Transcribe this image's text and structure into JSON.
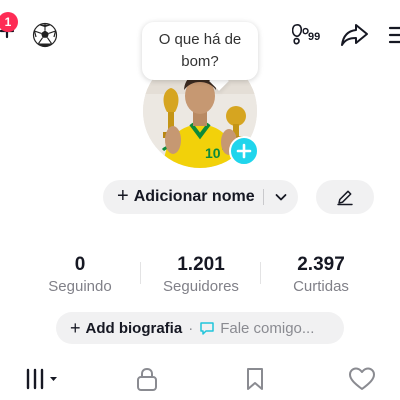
{
  "top_bar": {
    "notification_count": "1",
    "icons": [
      "plus-icon",
      "soccer-ball-icon",
      "footprints-icon",
      "share-icon",
      "menu-icon"
    ],
    "visitors_count": "99"
  },
  "bubble": {
    "text_line1": "O que há de",
    "text_line2": "bom?"
  },
  "profile": {
    "add_name_label": "Adicionar nome",
    "add_symbol": "+"
  },
  "stats": [
    {
      "value": "0",
      "label": "Seguindo"
    },
    {
      "value": "1.201",
      "label": "Seguidores"
    },
    {
      "value": "2.397",
      "label": "Curtidas"
    }
  ],
  "bio": {
    "add_label": "Add biografia",
    "separator": "·",
    "message_label": "Fale comigo..."
  },
  "tabs": [
    "videos-grid-icon",
    "lock-icon",
    "bookmark-icon",
    "heart-icon"
  ],
  "colors": {
    "badge": "#fe2c55",
    "accent_cyan": "#20d5ec",
    "pill_bg": "#f1f1f2",
    "muted_text": "#808088",
    "jersey_yellow": "#f2d10a",
    "jersey_green": "#0b8a3a"
  }
}
